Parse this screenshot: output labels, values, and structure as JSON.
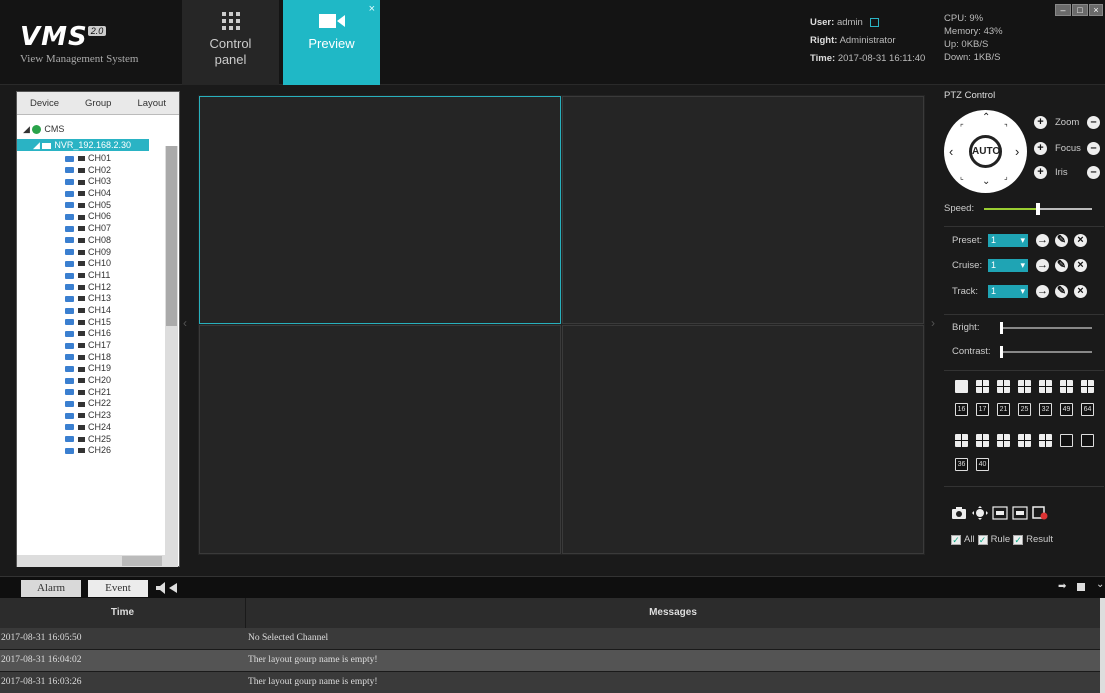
{
  "logo": {
    "name": "VMS",
    "version": "2.0",
    "subtitle": "View Management System"
  },
  "nav": {
    "control_panel": "Control panel",
    "preview": "Preview",
    "close_glyph": "×"
  },
  "user": {
    "user_label": "User:",
    "user_value": "admin",
    "right_label": "Right:",
    "right_value": "Administrator",
    "time_label": "Time:",
    "time_value": "2017-08-31 16:11:40"
  },
  "system": {
    "cpu": "CPU: 9%",
    "memory": "Memory: 43%",
    "up": "Up: 0KB/S",
    "down": "Down: 1KB/S"
  },
  "device_panel": {
    "tabs": [
      "Device",
      "Group",
      "Layout"
    ],
    "root": "CMS",
    "nvr": "NVR_192.168.2.30",
    "channels": [
      "CH01",
      "CH02",
      "CH03",
      "CH04",
      "CH05",
      "CH06",
      "CH07",
      "CH08",
      "CH09",
      "CH10",
      "CH11",
      "CH12",
      "CH13",
      "CH14",
      "CH15",
      "CH16",
      "CH17",
      "CH18",
      "CH19",
      "CH20",
      "CH21",
      "CH22",
      "CH23",
      "CH24",
      "CH25",
      "CH26"
    ]
  },
  "ptz": {
    "title": "PTZ Control",
    "auto": "AUTO",
    "zoom": "Zoom",
    "focus": "Focus",
    "iris": "Iris",
    "speed_label": "Speed:",
    "speed_level": 0.5,
    "preset_label": "Preset:",
    "preset_value": "1",
    "cruise_label": "Cruise:",
    "cruise_value": "1",
    "track_label": "Track:",
    "track_value": "1",
    "bright_label": "Bright:",
    "contrast_label": "Contrast:"
  },
  "layouts": {
    "row2": [
      "16",
      "17",
      "21",
      "25",
      "32",
      "49",
      "64"
    ],
    "row4": [
      "36",
      "40"
    ]
  },
  "filters": {
    "all": "All",
    "rule": "Rule",
    "result": "Result"
  },
  "bottom": {
    "alarm_tab": "Alarm",
    "event_tab": "Event"
  },
  "log": {
    "time_header": "Time",
    "messages_header": "Messages",
    "rows": [
      {
        "time": "2017-08-31 16:05:50",
        "message": "No Selected Channel"
      },
      {
        "time": "2017-08-31 16:04:02",
        "message": "Ther layout gourp name is empty!"
      },
      {
        "time": "2017-08-31 16:03:26",
        "message": "Ther layout gourp name is empty!"
      }
    ]
  },
  "colors": {
    "accent": "#1fb8c6",
    "active_cell": "#28b0bd",
    "speed_fill": "#9acd32"
  }
}
